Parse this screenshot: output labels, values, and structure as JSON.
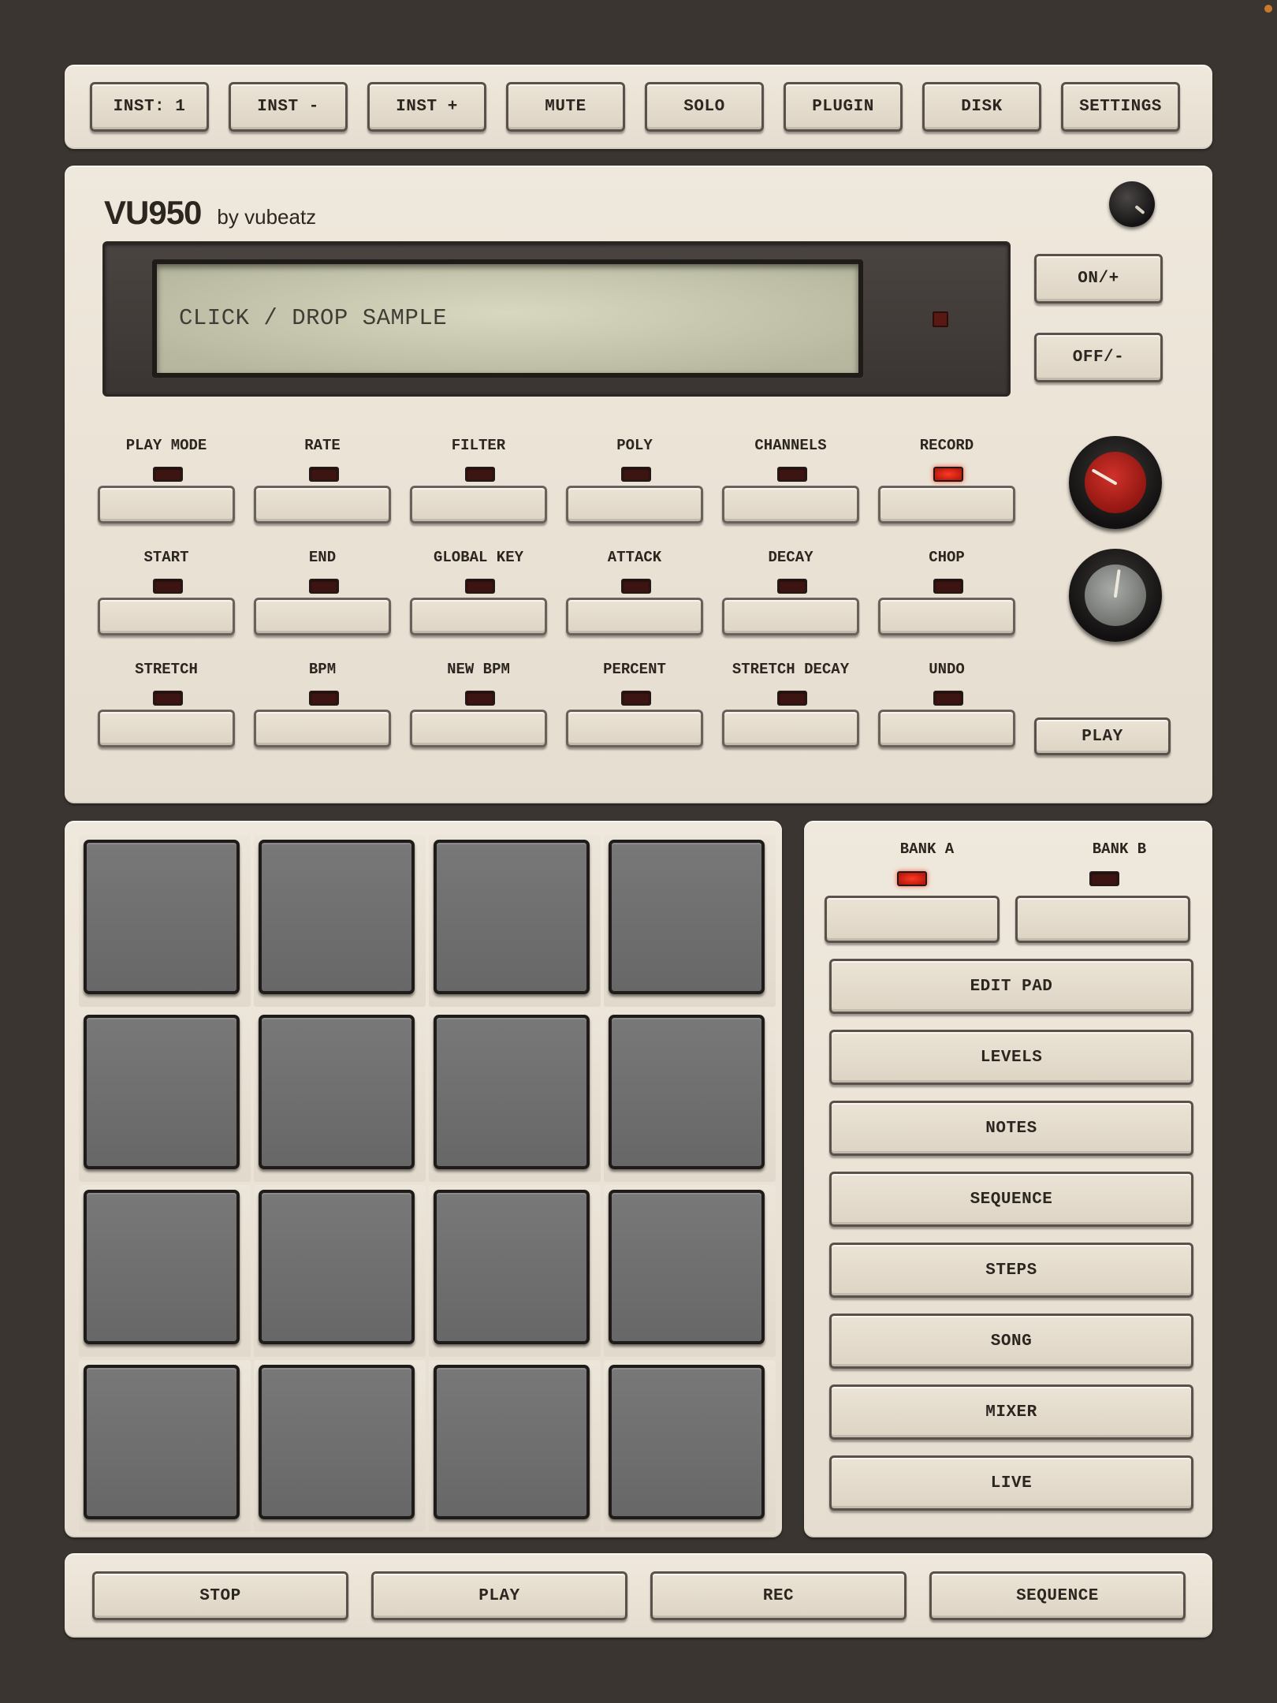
{
  "top_bar": {
    "buttons": [
      "INST: 1",
      "INST -",
      "INST +",
      "MUTE",
      "SOLO",
      "PLUGIN",
      "DISK",
      "SETTINGS"
    ]
  },
  "main": {
    "logo_main": "VU950",
    "logo_sub": "by vubeatz",
    "display_text": "CLICK / DROP SAMPLE",
    "on_button": "ON/+",
    "off_button": "OFF/-",
    "play_button": "PLAY",
    "params": [
      {
        "label": "PLAY MODE",
        "led_on": false
      },
      {
        "label": "RATE",
        "led_on": false
      },
      {
        "label": "FILTER",
        "led_on": false
      },
      {
        "label": "POLY",
        "led_on": false
      },
      {
        "label": "CHANNELS",
        "led_on": false
      },
      {
        "label": "RECORD",
        "led_on": true
      },
      {
        "label": "START",
        "led_on": false
      },
      {
        "label": "END",
        "led_on": false
      },
      {
        "label": "GLOBAL KEY",
        "led_on": false
      },
      {
        "label": "ATTACK",
        "led_on": false
      },
      {
        "label": "DECAY",
        "led_on": false
      },
      {
        "label": "CHOP",
        "led_on": false
      },
      {
        "label": "STRETCH",
        "led_on": false
      },
      {
        "label": "BPM",
        "led_on": false
      },
      {
        "label": "NEW BPM",
        "led_on": false
      },
      {
        "label": "PERCENT",
        "led_on": false
      },
      {
        "label": "STRETCH DECAY",
        "led_on": false
      },
      {
        "label": "UNDO",
        "led_on": false
      }
    ],
    "knobs": [
      {
        "name": "red-knob",
        "color": "#b81f18"
      },
      {
        "name": "grey-knob",
        "color": "#8a8c88"
      }
    ]
  },
  "pads": {
    "count": 16
  },
  "banks": {
    "bank_a": {
      "label": "BANK A",
      "led_on": true
    },
    "bank_b": {
      "label": "BANK B",
      "led_on": false
    },
    "modes": [
      "EDIT PAD",
      "LEVELS",
      "NOTES",
      "SEQUENCE",
      "STEPS",
      "SONG",
      "MIXER",
      "LIVE"
    ]
  },
  "transport": {
    "buttons": [
      "STOP",
      "PLAY",
      "REC",
      "SEQUENCE"
    ]
  },
  "colors": {
    "background": "#3a3530",
    "panel": "#e9e2d5",
    "pad": "#707070",
    "led_on": "#ff3a24",
    "led_off": "#3c1512"
  }
}
